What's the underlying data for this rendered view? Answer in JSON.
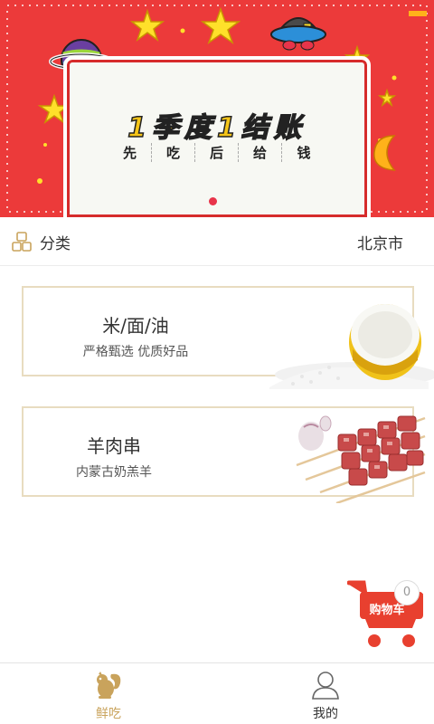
{
  "banner": {
    "title": "1季度1结账",
    "subtitle_chars": [
      "先",
      "吃",
      "后",
      "给",
      "钱"
    ],
    "active_slide": 1,
    "slide_count": 1
  },
  "category_bar": {
    "label": "分类",
    "city": "北京市"
  },
  "products": [
    {
      "name": "米/面/油",
      "desc": "严格甄选 优质好品",
      "image": "rice-bowl"
    },
    {
      "name": "羊肉串",
      "desc": "内蒙古奶羔羊",
      "image": "lamb-skewers"
    }
  ],
  "cart": {
    "label": "购物车",
    "count": "0"
  },
  "tabs": [
    {
      "label": "鲜吃",
      "icon": "squirrel-icon",
      "active": true
    },
    {
      "label": "我的",
      "icon": "user-icon",
      "active": false
    }
  ],
  "colors": {
    "banner_red": "#ec3a3a",
    "accent_gold": "#c9a35c",
    "card_border": "#e8dcc0",
    "cart_red": "#e8402f"
  }
}
